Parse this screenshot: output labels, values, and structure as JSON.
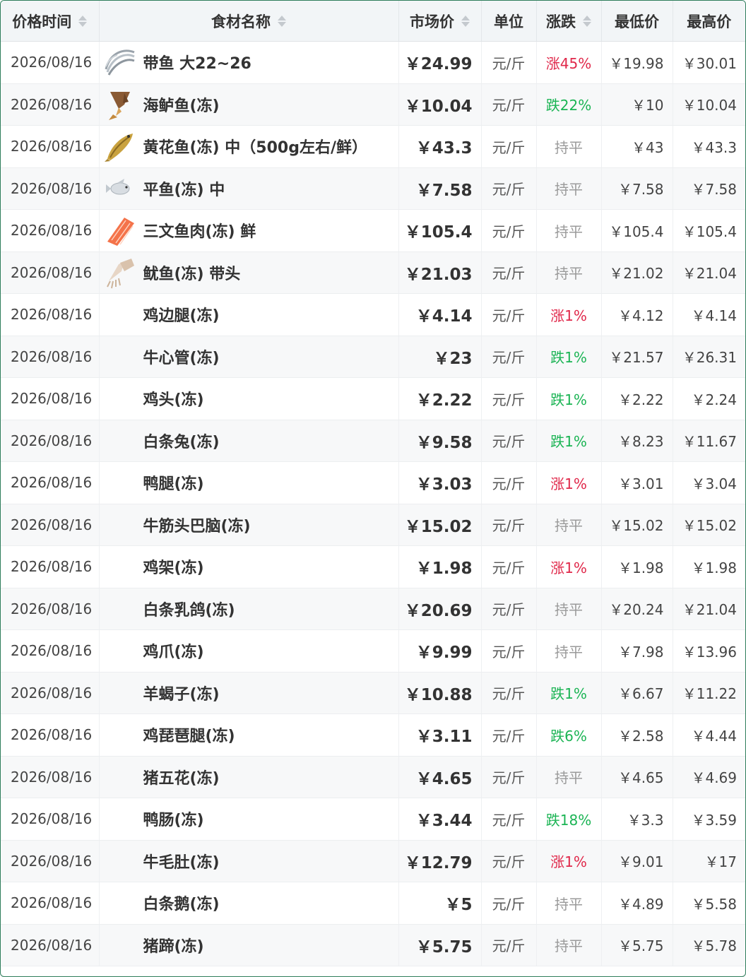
{
  "header": {
    "date": "价格时间",
    "name": "食材名称",
    "price": "市场价",
    "unit": "单位",
    "change": "涨跌",
    "min": "最低价",
    "max": "最高价"
  },
  "colors": {
    "rise": "#e0284a",
    "fall": "#1bb454",
    "flat": "#9a9a9a",
    "border": "#2e7d5b"
  },
  "rows": [
    {
      "date": "2026/08/16",
      "name": "带鱼 大22~26",
      "price": "￥24.99",
      "unit": "元/斤",
      "change": "涨45%",
      "trend": "rise",
      "min": "￥19.98",
      "max": "￥30.01",
      "thumb": "hairtail-fish-icon"
    },
    {
      "date": "2026/08/16",
      "name": "海鲈鱼(冻)",
      "price": "￥10.04",
      "unit": "元/斤",
      "change": "跌22%",
      "trend": "fall",
      "min": "￥10",
      "max": "￥10.04",
      "thumb": "sea-bass-icon"
    },
    {
      "date": "2026/08/16",
      "name": "黄花鱼(冻) 中（500g左右/鲜）",
      "price": "￥43.3",
      "unit": "元/斤",
      "change": "持平",
      "trend": "flat",
      "min": "￥43",
      "max": "￥43.3",
      "thumb": "yellow-croaker-icon"
    },
    {
      "date": "2026/08/16",
      "name": "平鱼(冻) 中",
      "price": "￥7.58",
      "unit": "元/斤",
      "change": "持平",
      "trend": "flat",
      "min": "￥7.58",
      "max": "￥7.58",
      "thumb": "pomfret-icon"
    },
    {
      "date": "2026/08/16",
      "name": "三文鱼肉(冻) 鲜",
      "price": "￥105.4",
      "unit": "元/斤",
      "change": "持平",
      "trend": "flat",
      "min": "￥105.4",
      "max": "￥105.4",
      "thumb": "salmon-fillet-icon"
    },
    {
      "date": "2026/08/16",
      "name": "鱿鱼(冻) 带头",
      "price": "￥21.03",
      "unit": "元/斤",
      "change": "持平",
      "trend": "flat",
      "min": "￥21.02",
      "max": "￥21.04",
      "thumb": "squid-icon"
    },
    {
      "date": "2026/08/16",
      "name": "鸡边腿(冻)",
      "price": "￥4.14",
      "unit": "元/斤",
      "change": "涨1%",
      "trend": "rise",
      "min": "￥4.12",
      "max": "￥4.14",
      "thumb": ""
    },
    {
      "date": "2026/08/16",
      "name": "牛心管(冻)",
      "price": "￥23",
      "unit": "元/斤",
      "change": "跌1%",
      "trend": "fall",
      "min": "￥21.57",
      "max": "￥26.31",
      "thumb": ""
    },
    {
      "date": "2026/08/16",
      "name": "鸡头(冻)",
      "price": "￥2.22",
      "unit": "元/斤",
      "change": "跌1%",
      "trend": "fall",
      "min": "￥2.22",
      "max": "￥2.24",
      "thumb": ""
    },
    {
      "date": "2026/08/16",
      "name": "白条兔(冻)",
      "price": "￥9.58",
      "unit": "元/斤",
      "change": "跌1%",
      "trend": "fall",
      "min": "￥8.23",
      "max": "￥11.67",
      "thumb": ""
    },
    {
      "date": "2026/08/16",
      "name": "鸭腿(冻)",
      "price": "￥3.03",
      "unit": "元/斤",
      "change": "涨1%",
      "trend": "rise",
      "min": "￥3.01",
      "max": "￥3.04",
      "thumb": ""
    },
    {
      "date": "2026/08/16",
      "name": "牛筋头巴脑(冻)",
      "price": "￥15.02",
      "unit": "元/斤",
      "change": "持平",
      "trend": "flat",
      "min": "￥15.02",
      "max": "￥15.02",
      "thumb": ""
    },
    {
      "date": "2026/08/16",
      "name": "鸡架(冻)",
      "price": "￥1.98",
      "unit": "元/斤",
      "change": "涨1%",
      "trend": "rise",
      "min": "￥1.98",
      "max": "￥1.98",
      "thumb": ""
    },
    {
      "date": "2026/08/16",
      "name": "白条乳鸽(冻)",
      "price": "￥20.69",
      "unit": "元/斤",
      "change": "持平",
      "trend": "flat",
      "min": "￥20.24",
      "max": "￥21.04",
      "thumb": ""
    },
    {
      "date": "2026/08/16",
      "name": "鸡爪(冻)",
      "price": "￥9.99",
      "unit": "元/斤",
      "change": "持平",
      "trend": "flat",
      "min": "￥7.98",
      "max": "￥13.96",
      "thumb": ""
    },
    {
      "date": "2026/08/16",
      "name": "羊蝎子(冻)",
      "price": "￥10.88",
      "unit": "元/斤",
      "change": "跌1%",
      "trend": "fall",
      "min": "￥6.67",
      "max": "￥11.22",
      "thumb": ""
    },
    {
      "date": "2026/08/16",
      "name": "鸡琵琶腿(冻)",
      "price": "￥3.11",
      "unit": "元/斤",
      "change": "跌6%",
      "trend": "fall",
      "min": "￥2.58",
      "max": "￥4.44",
      "thumb": ""
    },
    {
      "date": "2026/08/16",
      "name": "猪五花(冻)",
      "price": "￥4.65",
      "unit": "元/斤",
      "change": "持平",
      "trend": "flat",
      "min": "￥4.65",
      "max": "￥4.69",
      "thumb": ""
    },
    {
      "date": "2026/08/16",
      "name": "鸭肠(冻)",
      "price": "￥3.44",
      "unit": "元/斤",
      "change": "跌18%",
      "trend": "fall",
      "min": "￥3.3",
      "max": "￥3.59",
      "thumb": ""
    },
    {
      "date": "2026/08/16",
      "name": "牛毛肚(冻)",
      "price": "￥12.79",
      "unit": "元/斤",
      "change": "涨1%",
      "trend": "rise",
      "min": "￥9.01",
      "max": "￥17",
      "thumb": ""
    },
    {
      "date": "2026/08/16",
      "name": "白条鹅(冻)",
      "price": "￥5",
      "unit": "元/斤",
      "change": "持平",
      "trend": "flat",
      "min": "￥4.89",
      "max": "￥5.58",
      "thumb": ""
    },
    {
      "date": "2026/08/16",
      "name": "猪蹄(冻)",
      "price": "￥5.75",
      "unit": "元/斤",
      "change": "持平",
      "trend": "flat",
      "min": "￥5.75",
      "max": "￥5.78",
      "thumb": ""
    }
  ]
}
